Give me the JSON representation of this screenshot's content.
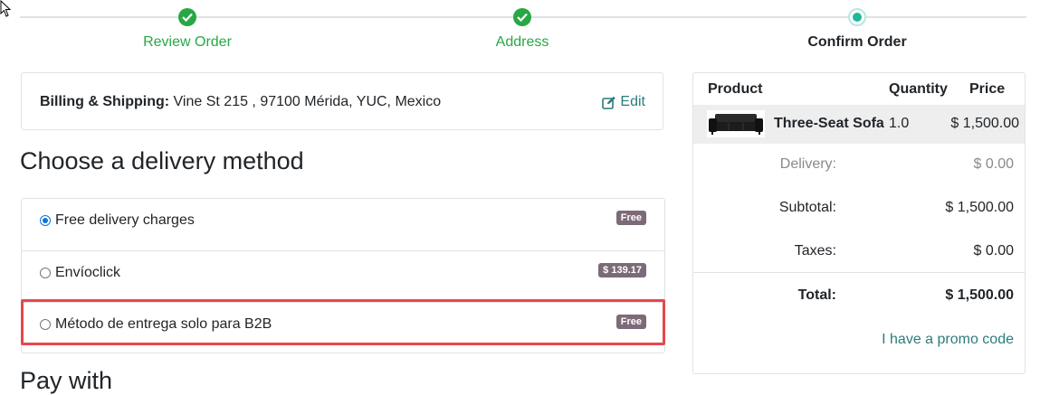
{
  "wizard": {
    "steps": [
      {
        "label": "Review Order",
        "state": "done"
      },
      {
        "label": "Address",
        "state": "done"
      },
      {
        "label": "Confirm Order",
        "state": "current"
      }
    ]
  },
  "billing": {
    "heading": "Billing & Shipping:",
    "address": "Vine St 215 , 97100 Mérida, YUC, Mexico",
    "edit_label": "Edit"
  },
  "delivery": {
    "title": "Choose a delivery method",
    "methods": [
      {
        "label": "Free delivery charges",
        "price": "Free",
        "selected": true
      },
      {
        "label": "Envíoclick",
        "price": "$ 139.17",
        "selected": false
      },
      {
        "label": "Método de entrega solo para B2B",
        "price": "Free",
        "selected": false
      }
    ]
  },
  "payment": {
    "title": "Pay with"
  },
  "summary": {
    "headers": {
      "product": "Product",
      "quantity": "Quantity",
      "price": "Price"
    },
    "items": [
      {
        "name": "Three-Seat Sofa",
        "quantity": "1.0",
        "price": "$ 1,500.00",
        "icon": "sofa-icon"
      }
    ],
    "delivery_label": "Delivery:",
    "delivery_value": "$ 0.00",
    "subtotal_label": "Subtotal:",
    "subtotal_value": "$ 1,500.00",
    "taxes_label": "Taxes:",
    "taxes_value": "$ 0.00",
    "total_label": "Total:",
    "total_value": "$ 1,500.00",
    "promo_label": "I have a promo code"
  },
  "colors": {
    "success": "#28a745",
    "accent": "#21b799",
    "link": "#2b7c7c",
    "badge": "#7d6a78",
    "highlight": "#e5484d"
  }
}
